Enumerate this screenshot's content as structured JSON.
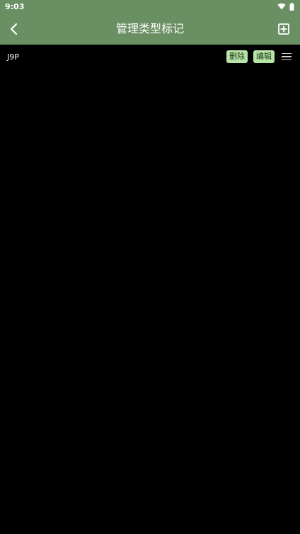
{
  "status_bar": {
    "time": "9:03"
  },
  "app_bar": {
    "title": "管理类型标记"
  },
  "rows": [
    {
      "name": "J9P",
      "delete_label": "删除",
      "edit_label": "编辑"
    }
  ],
  "colors": {
    "primary": "#6a8f62",
    "chip_bg": "#b7e3a8",
    "background": "#000000"
  },
  "icons": {
    "back": "back-arrow-icon",
    "add": "add-box-icon",
    "drag": "drag-handle-icon",
    "wifi": "wifi-icon",
    "battery": "battery-icon"
  }
}
